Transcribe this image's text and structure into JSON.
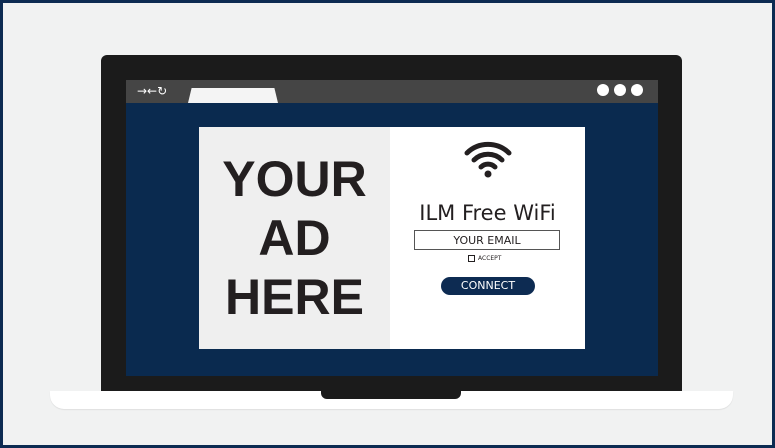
{
  "browser": {
    "nav_icons": "→←↻",
    "menu_dots": [
      "dot",
      "dot",
      "dot"
    ]
  },
  "ad": {
    "lines": [
      "YOUR",
      "AD",
      "HERE"
    ]
  },
  "login": {
    "icon": "wifi-icon",
    "title": "ILM Free WiFi",
    "email_placeholder": "YOUR EMAIL",
    "accept_label": "ACCEPT",
    "connect_label": "CONNECT"
  },
  "colors": {
    "navy": "#0d2b52",
    "screen_bg": "#0a2a4f",
    "laptop_frame": "#1b1b1b",
    "browser_bar": "#454545",
    "ad_bg": "#efefef",
    "text": "#231f20"
  }
}
